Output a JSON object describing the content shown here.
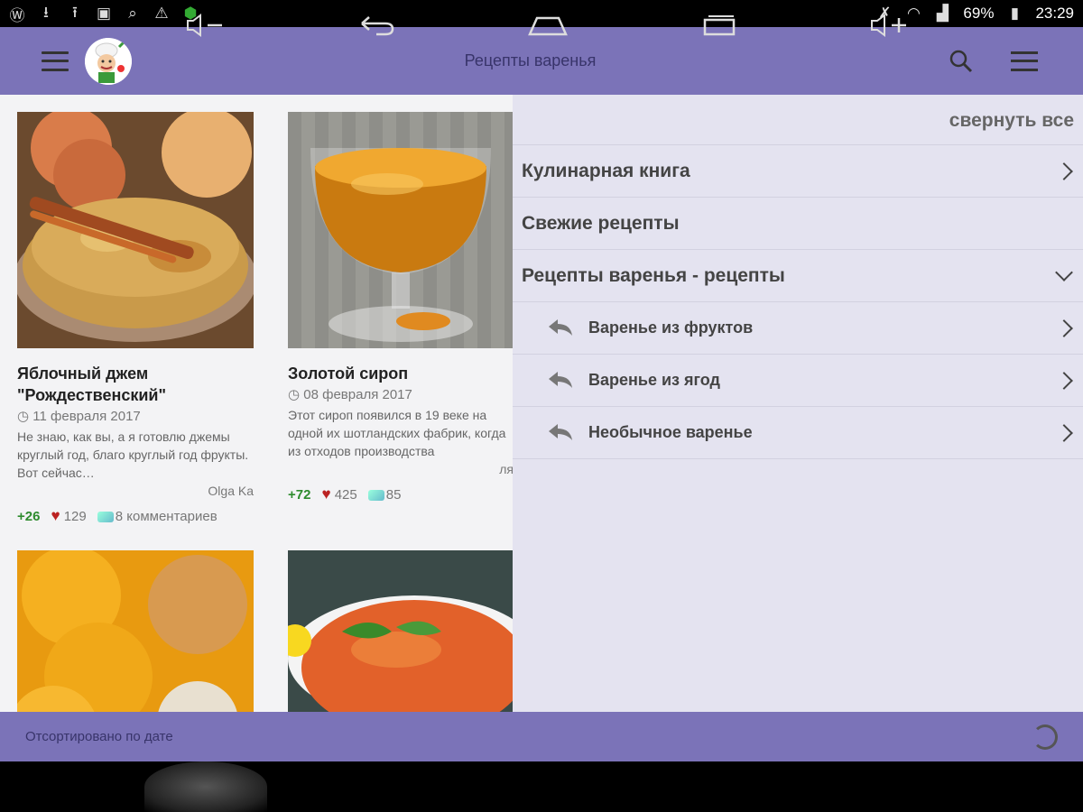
{
  "status_bar": {
    "battery": "69%",
    "time": "23:29"
  },
  "app_bar": {
    "title": "Рецепты варенья"
  },
  "cards": [
    {
      "title": "Яблочный джем \"Рождественский\"",
      "date": "11 февраля 2017",
      "description": "Не знаю, как вы, а я готовлю джемы круглый год, благо круглый год фрукты. Вот сейчас…",
      "author": "Olga Ka",
      "plus": "+26",
      "likes": "129",
      "comments": "8 комментариев"
    },
    {
      "title": "Золотой сироп",
      "date": "08 февраля 2017",
      "description": "Этот сироп появился в 19 веке на одной их шотландских фабрик, когда из отходов производства",
      "author": "ля",
      "plus": "+72",
      "likes": "425",
      "comments": "85"
    }
  ],
  "drawer": {
    "collapse_all": "свернуть все",
    "items": [
      {
        "label": "Кулинарная книга"
      },
      {
        "label": "Свежие рецепты"
      },
      {
        "label": "Рецепты варенья - рецепты"
      }
    ],
    "sub_items": [
      {
        "label": "Варенье из фруктов"
      },
      {
        "label": "Варенье из ягод"
      },
      {
        "label": "Необычное варенье"
      }
    ]
  },
  "bottom_bar": {
    "sort_label": "Отсортировано по дате"
  },
  "colors": {
    "app_bar": "#7b73b8",
    "drawer_bg": "#e4e3f0",
    "positive": "#2e8b2e"
  }
}
